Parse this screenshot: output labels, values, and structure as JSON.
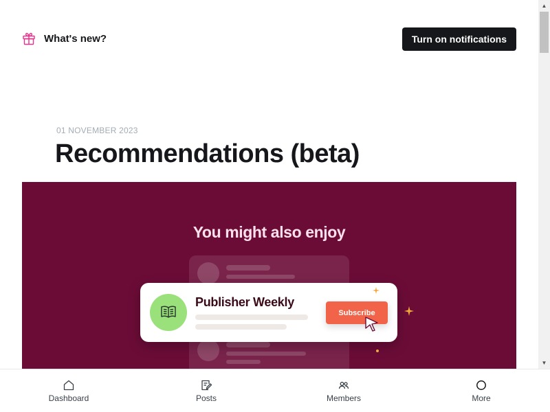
{
  "header": {
    "title": "What's new?",
    "notify_button": "Turn on notifications",
    "icon": "gift-icon"
  },
  "post": {
    "date": "01 NOVEMBER 2023",
    "title": "Recommendations (beta)"
  },
  "hero": {
    "heading": "You might also enjoy",
    "publication_name": "Publisher Weekly",
    "subscribe_label": "Subscribe",
    "background_color": "#6b0c37",
    "accent_color": "#f26449"
  },
  "bottom_nav": {
    "items": [
      {
        "label": "Dashboard",
        "icon": "home-icon"
      },
      {
        "label": "Posts",
        "icon": "posts-icon"
      },
      {
        "label": "Members",
        "icon": "members-icon"
      },
      {
        "label": "More",
        "icon": "more-icon"
      }
    ]
  }
}
